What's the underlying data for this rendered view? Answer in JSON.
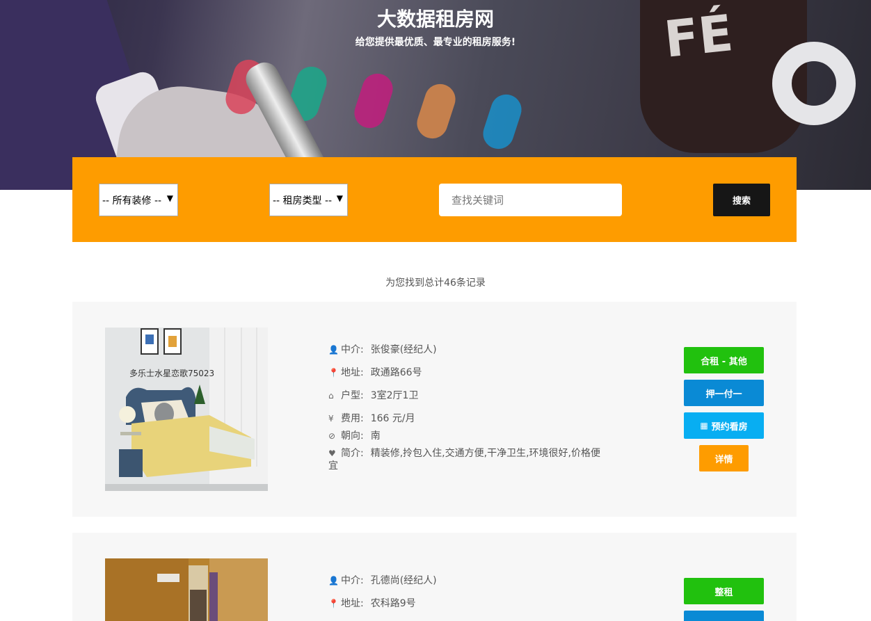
{
  "header": {
    "title": "大数据租房网",
    "subtitle": "给您提供最优质、最专业的租房服务!",
    "hero_mug_text": "FÉ"
  },
  "search": {
    "decoration_select": "-- 所有装修 --",
    "rent_type_select": "-- 租房类型 --",
    "keyword_placeholder": "查找关键词",
    "search_button": "搜索"
  },
  "result_count": "为您找到总计46条记录",
  "listings": [
    {
      "photo_caption": "多乐士水星恋歌75023",
      "agent_label": "中介:",
      "agent": "张俊豪(经纪人)",
      "address_label": "地址:",
      "address": "政通路66号",
      "layout_label": "户型:",
      "layout": "3室2厅1卫",
      "fee_label": "费用:",
      "fee": "166 元/月",
      "orientation_label": "朝向:",
      "orientation": "南",
      "intro_label": "简介:",
      "intro": "精装修,拎包入住,交通方便,干净卫生,环境很好,价格便宜",
      "rent_mode_button": "合租 - 其他",
      "payment_button": "押一付一",
      "appointment_button": "预约看房",
      "details_button": "详情"
    },
    {
      "agent_label": "中介:",
      "agent": "孔德尚(经纪人)",
      "address_label": "地址:",
      "address": "农科路9号",
      "rent_mode_button": "整租"
    }
  ],
  "colors": {
    "search_bar": "#fe9c00",
    "rent_mode": "#21c10e",
    "payment": "#0a8ad5",
    "appointment": "#08aef2",
    "details": "#fe9c00"
  },
  "icons": {
    "agent": "user-icon",
    "address": "map-marker-icon",
    "layout": "home-icon",
    "fee": "yen-icon",
    "orientation": "compass-icon",
    "intro": "heart-icon",
    "appointment": "calendar-icon"
  }
}
